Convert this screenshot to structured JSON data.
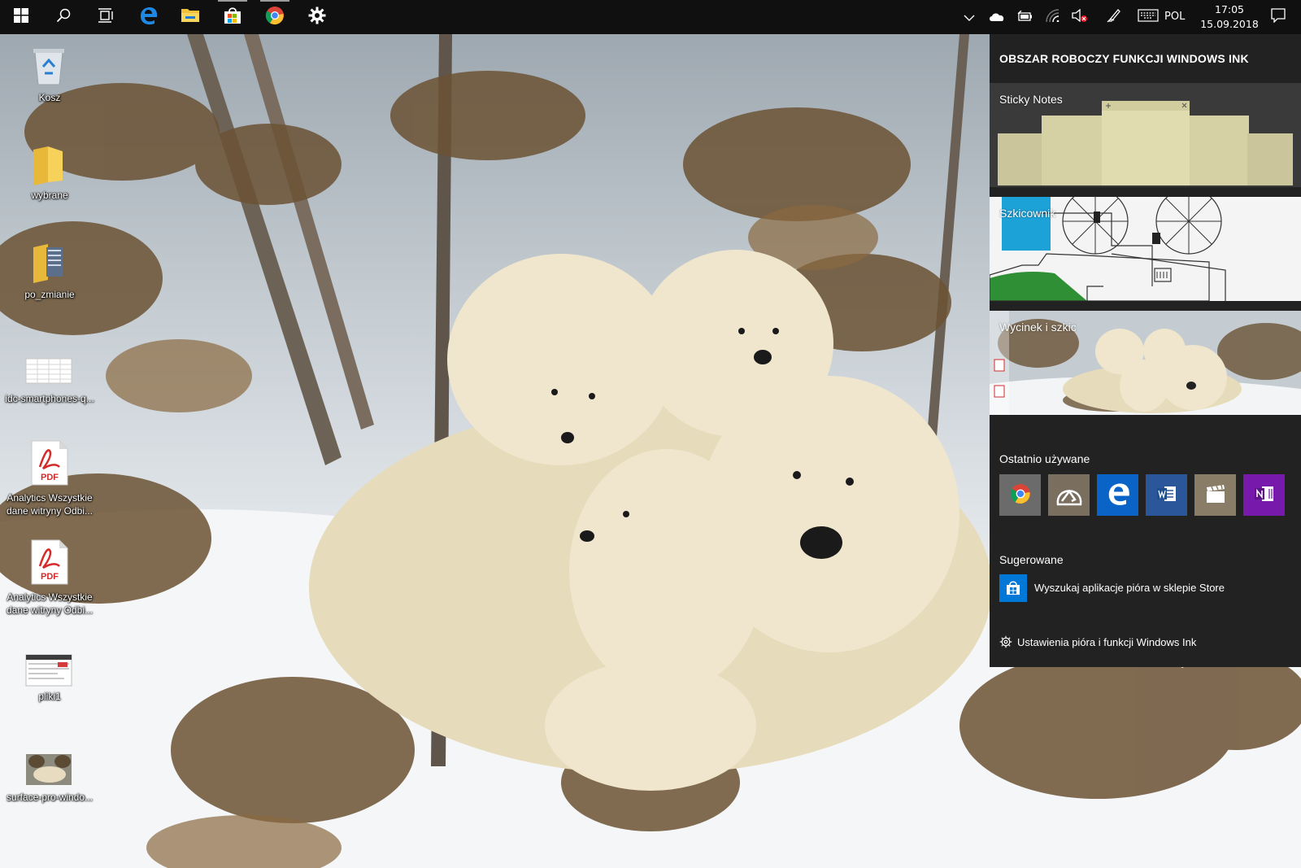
{
  "taskbar": {
    "pinned": [
      {
        "name": "start-icon"
      },
      {
        "name": "search-icon"
      },
      {
        "name": "task-view-icon"
      },
      {
        "name": "edge-icon"
      },
      {
        "name": "file-explorer-icon"
      },
      {
        "name": "store-icon"
      },
      {
        "name": "chrome-icon"
      },
      {
        "name": "settings-icon"
      }
    ],
    "tray": {
      "language": "POL",
      "time": "17:05",
      "date": "15.09.2018"
    }
  },
  "desktop": {
    "icons": [
      {
        "label": "Kosz",
        "type": "recycle-bin"
      },
      {
        "label": "wybrane",
        "type": "folder"
      },
      {
        "label": "po_zmianie",
        "type": "folder-docs"
      },
      {
        "label": "idc-smartphones-q...",
        "type": "image-thumb"
      },
      {
        "label": "Analytics Wszystkie dane witryny Odbi...",
        "type": "pdf",
        "badge": "PDF"
      },
      {
        "label": "Analytics Wszystkie dane witryny Odbi...",
        "type": "pdf",
        "badge": "PDF"
      },
      {
        "label": "pliki1",
        "type": "image-thumb"
      },
      {
        "label": "surface-pro-windo...",
        "type": "photo-thumb"
      }
    ]
  },
  "ink_workspace": {
    "title": "OBSZAR ROBOCZY FUNKCJI WINDOWS INK",
    "tiles": {
      "sticky_notes": "Sticky Notes",
      "sketchpad": "Szkicownik",
      "snip_sketch": "Wycinek i szkic"
    },
    "recent": {
      "heading": "Ostatnio używane",
      "apps": [
        {
          "name": "chrome",
          "color": "#6b6b6b"
        },
        {
          "name": "drawboard",
          "color": "#7a6e5e"
        },
        {
          "name": "edge",
          "color": "#0a64c8"
        },
        {
          "name": "word",
          "color": "#2b579a"
        },
        {
          "name": "movie-maker",
          "color": "#8a7d68"
        },
        {
          "name": "onenote",
          "color": "#7719aa"
        }
      ]
    },
    "suggested": {
      "heading": "Sugerowane",
      "store_link": "Wyszukaj aplikacje pióra w sklepie Store"
    },
    "settings_link": "Ustawienia pióra i funkcji Windows Ink"
  }
}
